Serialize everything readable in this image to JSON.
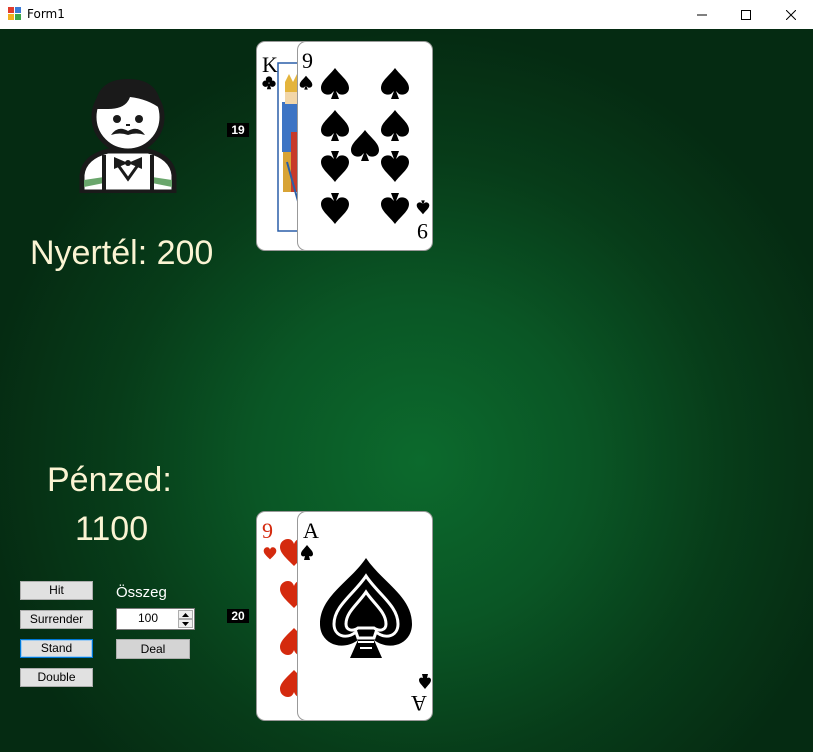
{
  "window": {
    "title": "Form1"
  },
  "dealer": {
    "score": "19",
    "cards": [
      {
        "rank": "K",
        "suit": "clubs",
        "face": "clubs-king-card"
      },
      {
        "rank": "9",
        "suit": "spades",
        "face": "nine-of-spades-card"
      }
    ]
  },
  "result_text": "Nyertél: 200",
  "money": {
    "label": "Pénzed:",
    "value": "1100"
  },
  "player": {
    "score": "20",
    "cards": [
      {
        "rank": "9",
        "suit": "hearts",
        "face": "nine-of-hearts-card"
      },
      {
        "rank": "A",
        "suit": "spades",
        "face": "ace-of-spades-card"
      }
    ]
  },
  "controls": {
    "hit_label": "Hit",
    "surrender_label": "Surrender",
    "stand_label": "Stand",
    "double_label": "Double",
    "bet_label": "Összeg",
    "bet_value": "100",
    "deal_label": "Deal"
  },
  "colors": {
    "felt": "#0a5625",
    "text": "#fbf4d3",
    "red_suit": "#d42a0e"
  }
}
